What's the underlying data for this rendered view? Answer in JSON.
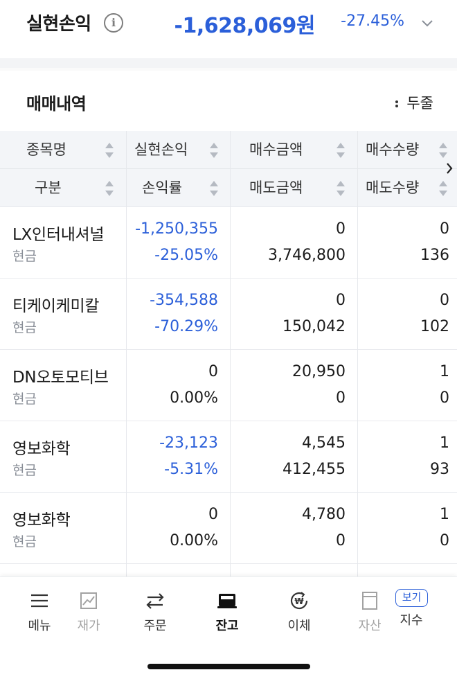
{
  "summary": {
    "title": "실현손익",
    "info_icon": "info-icon",
    "amount": "-1,628,069원",
    "percent": "-27.45%",
    "expand_icon": "chevron-down-icon"
  },
  "section": {
    "title": "매매내역",
    "fold_label": "두줄"
  },
  "table": {
    "headers_row1": [
      "종목명",
      "실현손익",
      "매수금액",
      "매수수량"
    ],
    "headers_row2": [
      "구분",
      "손익률",
      "매도금액",
      "매도수량"
    ],
    "rows": [
      {
        "name": "LX인터내셔널",
        "kind": "현금",
        "pnl": "-1,250,355",
        "rate": "-25.05%",
        "buy_amt": "0",
        "sell_amt": "3,746,800",
        "buy_qty": "0",
        "sell_qty": "136"
      },
      {
        "name": "티케이케미칼",
        "kind": "현금",
        "pnl": "-354,588",
        "rate": "-70.29%",
        "buy_amt": "0",
        "sell_amt": "150,042",
        "buy_qty": "0",
        "sell_qty": "102"
      },
      {
        "name": "DN오토모티브",
        "kind": "현금",
        "pnl": "0",
        "rate": "0.00%",
        "buy_amt": "20,950",
        "sell_amt": "0",
        "buy_qty": "1",
        "sell_qty": "0"
      },
      {
        "name": "영보화학",
        "kind": "현금",
        "pnl": "-23,123",
        "rate": "-5.31%",
        "buy_amt": "4,545",
        "sell_amt": "412,455",
        "buy_qty": "1",
        "sell_qty": "93"
      },
      {
        "name": "영보화학",
        "kind": "현금",
        "pnl": "0",
        "rate": "0.00%",
        "buy_amt": "4,780",
        "sell_amt": "0",
        "buy_qty": "1",
        "sell_qty": "0"
      }
    ]
  },
  "nav": {
    "items": [
      {
        "label": "메뉴",
        "icon": "hamburger-menu-icon"
      },
      {
        "label": "재가",
        "icon": "chart-icon"
      },
      {
        "label": "주문",
        "icon": "swap-arrows-icon"
      },
      {
        "label": "잔고",
        "icon": "wallet-icon"
      },
      {
        "label": "이체",
        "icon": "won-transfer-icon"
      },
      {
        "label": "자산",
        "icon": "document-icon"
      },
      {
        "label": "지수",
        "icon": "index-icon"
      }
    ],
    "badge": "보기"
  },
  "colors": {
    "negative": "#2b5fd9",
    "header_bg": "#f3f5f8"
  }
}
